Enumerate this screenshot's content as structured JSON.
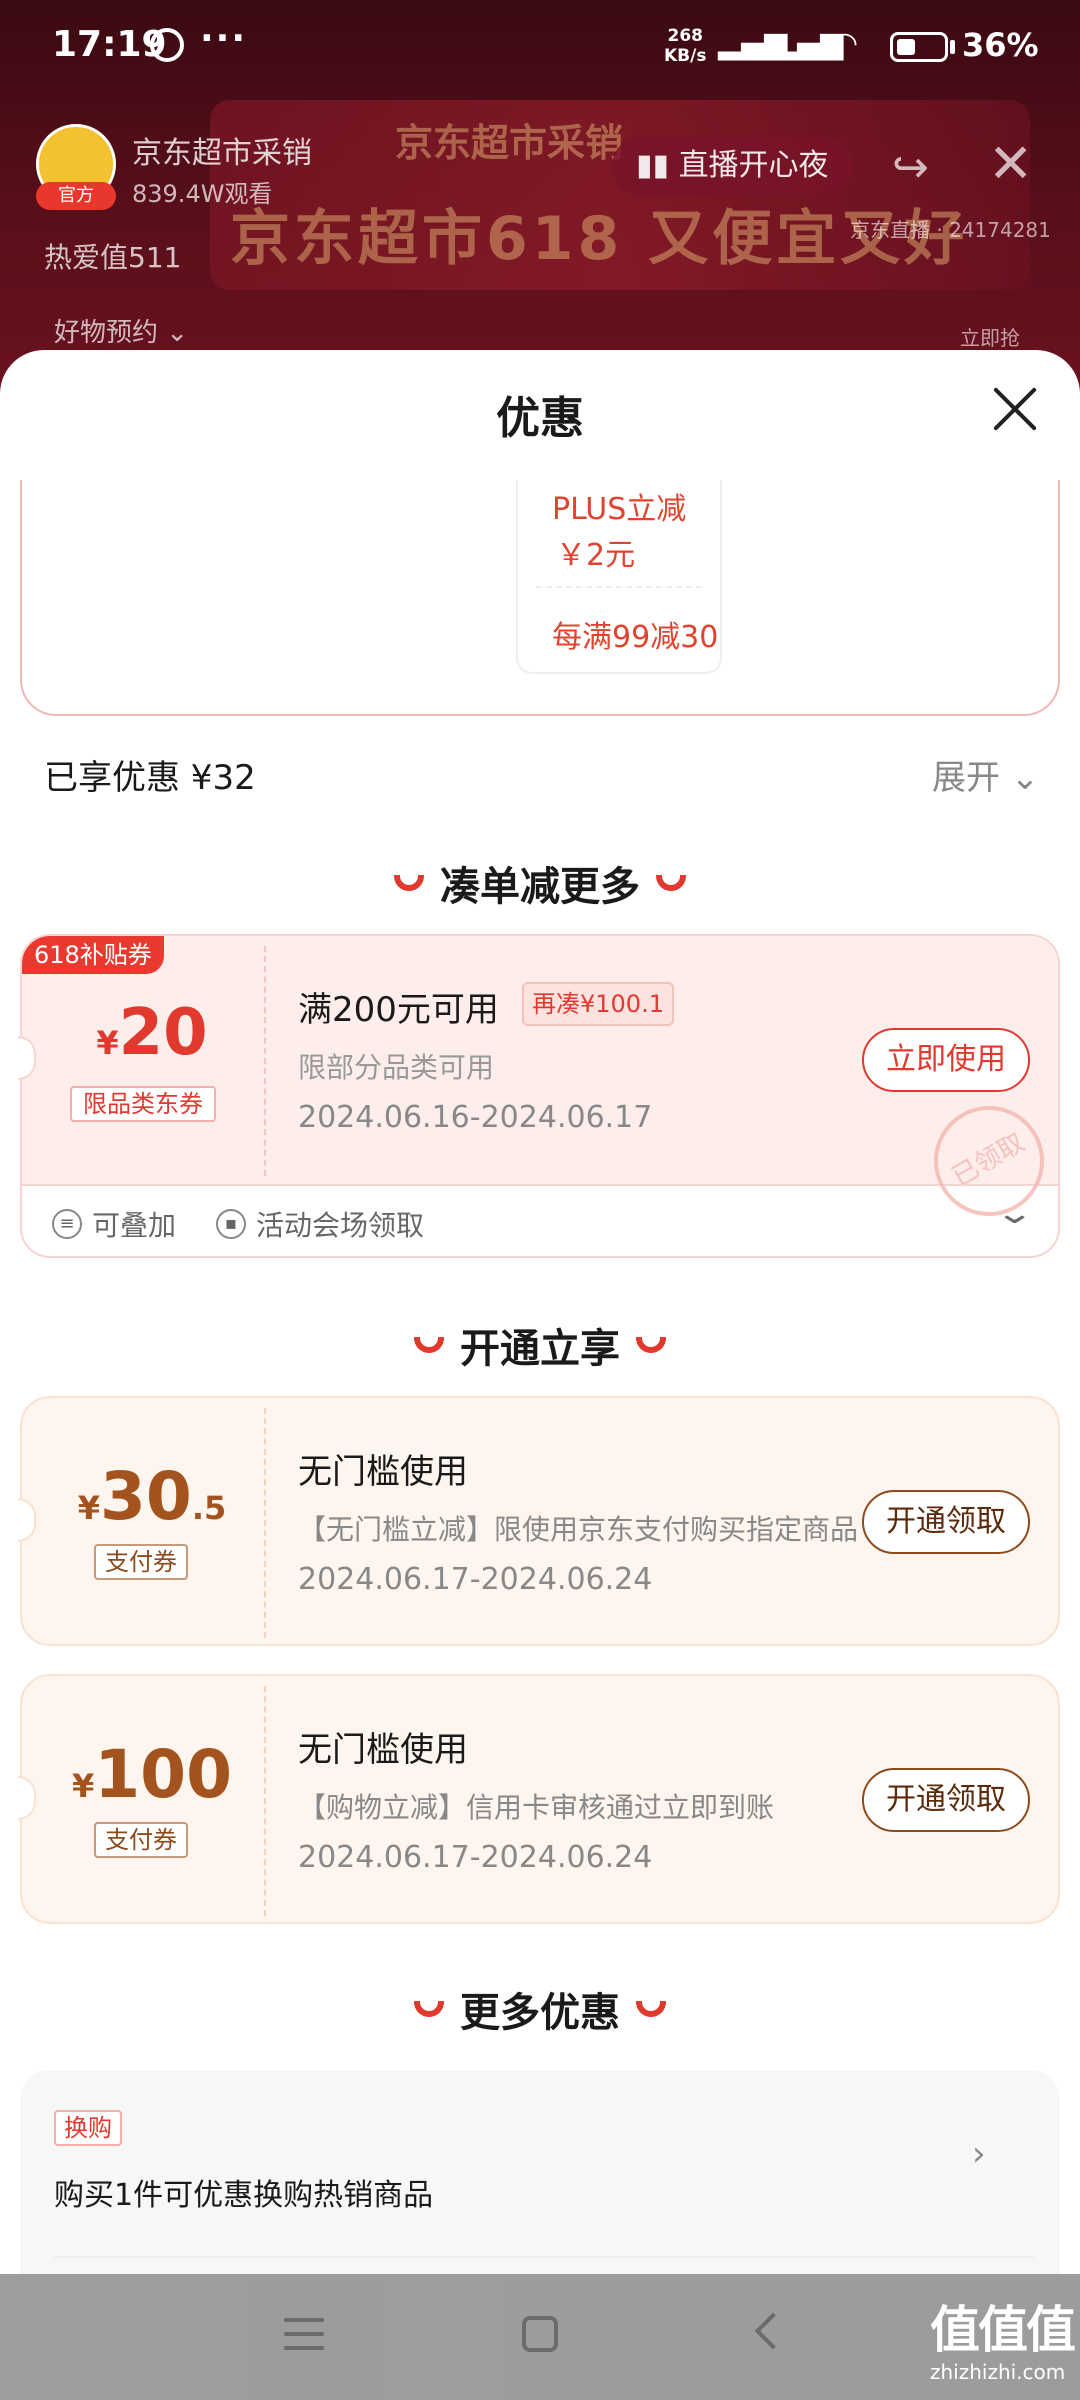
{
  "status_bar": {
    "time": "17:19",
    "dots": "···",
    "net_speed_value": "268",
    "net_speed_unit": "KB/s",
    "battery": "36%"
  },
  "live": {
    "host_name": "京东超市采销",
    "viewers": "839.4W观看",
    "badge": "官方",
    "banner_sub": "京东超市采销",
    "banner_title": "京东超市618 又便宜又好",
    "live_button": "直播开心夜",
    "room_id": "京东直播 · 24174281",
    "love_value": "热爱值511",
    "goods_reserve": "好物预约 ⌄",
    "buy_now": "立即抢"
  },
  "sheet": {
    "title": "优惠",
    "prev_card": {
      "plus_line1": "PLUS立减",
      "plus_line2": "￥2元",
      "full_reduction": "每满99减30"
    },
    "enjoyed": "已享优惠 ¥32",
    "expand": "展开 ⌄",
    "sections": {
      "more_items": "凑单减更多",
      "open_now": "开通立享",
      "more_offers": "更多优惠"
    },
    "coupon_618": {
      "tag": "618补贴券",
      "currency": "¥",
      "amount": "20",
      "badge": "限品类东券",
      "condition": "满200元可用",
      "again": "再凑¥100.1",
      "desc": "限部分品类可用",
      "dates": "2024.06.16-2024.06.17",
      "button": "立即使用",
      "stamp": "已领取",
      "stackable": "可叠加",
      "source": "活动会场领取"
    },
    "coupon_pay1": {
      "currency": "¥",
      "amount": "30",
      "amount_dec": ".5",
      "badge": "支付券",
      "condition": "无门槛使用",
      "desc": "【无门槛立减】限使用京东支付购买指定商品",
      "dates": "2024.06.17-2024.06.24",
      "button": "开通领取"
    },
    "coupon_pay2": {
      "currency": "¥",
      "amount": "100",
      "badge": "支付券",
      "condition": "无门槛使用",
      "desc": "【购物立减】信用卡审核通过立即到账",
      "dates": "2024.06.17-2024.06.24",
      "button": "开通领取"
    },
    "more": {
      "tag": "换购",
      "text": "购买1件可优惠换购热销商品"
    }
  },
  "watermark": {
    "logo": "值值值",
    "url": "zhizhizhi.com"
  },
  "colors": {
    "accent_red": "#e2392f",
    "brown": "#8d4a1c",
    "coupon_bg_red": "#fdeeec",
    "coupon_bg_orange": "#fef5ee"
  }
}
